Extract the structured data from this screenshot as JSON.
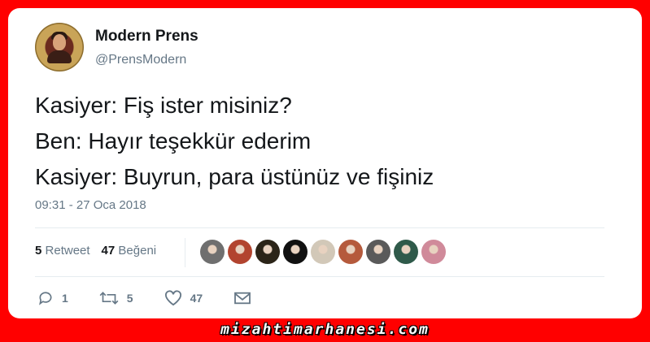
{
  "tweet": {
    "author_name": "Modern Prens",
    "author_handle": "@PrensModern",
    "text_lines": [
      "Kasiyer: Fiş ister misiniz?",
      "Ben: Hayır teşekkür ederim",
      "Kasiyer: Buyrun, para üstünüz ve fişiniz"
    ],
    "timestamp": "09:31 - 27 Oca 2018"
  },
  "stats": {
    "retweet_count": "5",
    "retweet_label": "Retweet",
    "like_count": "47",
    "like_label": "Beğeni"
  },
  "likers": [
    {
      "color": "#6f6f6f"
    },
    {
      "color": "#b2442f"
    },
    {
      "color": "#2b2418"
    },
    {
      "color": "#111111"
    },
    {
      "color": "#d2c8b8"
    },
    {
      "color": "#b55a3c"
    },
    {
      "color": "#5a5a5a"
    },
    {
      "color": "#2f5a4a"
    },
    {
      "color": "#d08a9a"
    }
  ],
  "actions": {
    "reply_count": "1",
    "retweet_count": "5",
    "like_count": "47"
  },
  "watermark": "mizahtimarhanesi.com",
  "colors": {
    "frame": "#ff0000",
    "muted": "#657786",
    "text": "#14171a"
  }
}
